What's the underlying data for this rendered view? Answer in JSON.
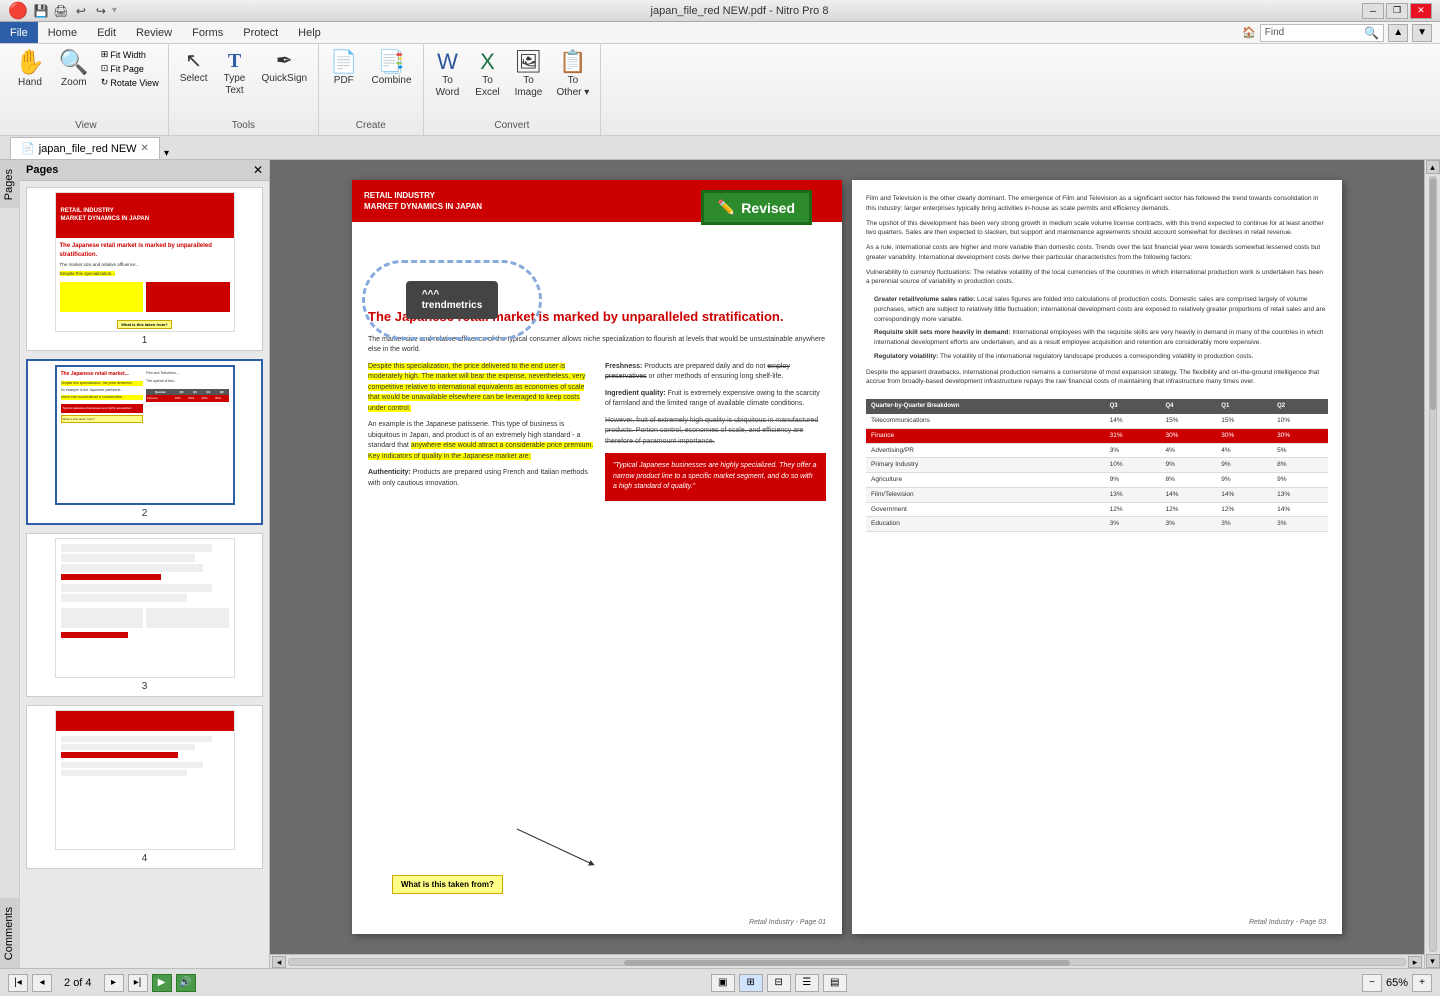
{
  "titlebar": {
    "title": "japan_file_red NEW.pdf - Nitro Pro 8",
    "minimize": "─",
    "restore": "❐",
    "close": "✕"
  },
  "menubar": {
    "items": [
      "File",
      "Home",
      "Edit",
      "Review",
      "Forms",
      "Protect",
      "Help"
    ],
    "active": "File",
    "find_placeholder": "Find"
  },
  "ribbon": {
    "groups": [
      {
        "label": "View",
        "items_small": [
          "Fit Width",
          "Fit Page",
          "Rotate View"
        ],
        "items_large": [
          {
            "icon": "✋",
            "label": "Hand"
          },
          {
            "icon": "🔍",
            "label": "Zoom"
          }
        ]
      },
      {
        "label": "Tools",
        "items": [
          {
            "icon": "↖",
            "label": "Select"
          },
          {
            "icon": "T",
            "label": "Type\nText"
          },
          {
            "icon": "✒",
            "label": "QuickSign"
          }
        ]
      },
      {
        "label": "Create",
        "items": [
          {
            "icon": "📄",
            "label": "PDF"
          },
          {
            "icon": "🔗",
            "label": "Combine"
          }
        ]
      },
      {
        "label": "Convert",
        "items": [
          {
            "icon": "W",
            "label": "To\nWord"
          },
          {
            "icon": "X",
            "label": "To\nExcel"
          },
          {
            "icon": "🖼",
            "label": "To\nImage"
          },
          {
            "icon": "▸",
            "label": "To\nOther"
          }
        ]
      }
    ]
  },
  "tabs": [
    {
      "label": "japan_file_red NEW",
      "active": true,
      "icon": "📄"
    }
  ],
  "sidebar": {
    "panels": [
      "Pages",
      "Comments"
    ],
    "active": "Pages"
  },
  "pages": {
    "total": 4,
    "current": 2,
    "items": [
      {
        "number": "1"
      },
      {
        "number": "2"
      },
      {
        "number": "3"
      },
      {
        "number": "4"
      }
    ]
  },
  "page_left": {
    "header_text": "RETAIL INDUSTRY\nMARKET DYNAMICS IN JAPAN",
    "revised_label": "Revised",
    "logo_text": "trendmetrics",
    "main_heading": "The Japanese retail market is marked by unparalleled stratification.",
    "intro_text": "The market size and relative affluence of the typical consumer allows niche specialization to flourish at levels that would be unsustainable anywhere else in the world.",
    "col1_highlighted": "Despite this specialization, the price delivered to the end user is moderately high. The market will bear the expense, nevertheless, very competitive relative to international equivalents as economies of scale that would be unavailable elsewhere can be leveraged to keep costs under control.",
    "col1_para2": "An example is the Japanese patisserie. This type of business is ubiquitous in Japan, and product is of an extremely high standard - a standard that anywhere else would attract a considerable price premium. Key indicators of quality in the Japanese market are:",
    "col2_freshness": "Freshness: Products are prepared daily and do not employ preservatives or other methods of ensuring long shelf-life.",
    "col2_ingredient": "Ingredient quality: Fruit is extremely expensive owing to the scarcity of farmland and the limited range of available climate conditions.",
    "col2_para3_strike": "However, fruit of extremely high quality is ubiquitous in manufactured products. Portion control, economies of scale, and efficiency are therefore of paramount importance.",
    "col2_authenticity": "Authenticity: Products are prepared using French and Italian methods with only cautious innovation.",
    "red_box_text": "\"Typical Japanese businesses are highly specialized. They offer a narrow product line to a specific market segment, and do so with a high standard of quality.\"",
    "annotation_text": "What is this taken from?",
    "footer": "Retail Industry - Page 01"
  },
  "page_right": {
    "para1": "Film and Television is the other clearly dominant. The emergence of Film and Television as a significant sector has followed the trend towards consolidation in this industry: larger enterprises typically bring activities in-house as scale permits and efficiency demands.",
    "para2": "The upshot of this development has been very strong growth in medium scale volume license contracts, with this trend expected to continue for at least another two quarters. Sales are then expected to slacken, but support and maintenance agreements should account somewhat for declines in retail revenue.",
    "para3": "As a rule, international costs are higher and more variable than domestic costs. Trends over the last financial year were towards somewhat lessened costs but greater variability. International development costs derive their particular characteristics from the following factors:",
    "para4": "Vulnerability to currency fluctuations: The relative volatility of the local currencies of the countries in which international production work is undertaken has been a perennial source of variability in production costs.",
    "bullet1_title": "Greater retail/volume sales ratio:",
    "bullet1_text": "Local sales figures are folded into calculations of production costs. Domestic sales are comprised largely of volume purchases, which are subject to relatively little fluctuation; international development costs are exposed to relatively greater proportions of retail sales and are correspondingly more variable.",
    "bullet2_title": "Requisite skill sets more heavily in demand:",
    "bullet2_text": "International employees with the requisite skills are very heavily in demand in many of the countries in which international development efforts are undertaken, and as a result employee acquisition and retention are considerably more expensive.",
    "bullet3_title": "Regulatory volatility:",
    "bullet3_text": "The volatility of the international regulatory landscape produces a corresponding volatility in production costs.",
    "closing": "Despite the apparent drawbacks, international production remains a cornerstone of most expansion strategy. The flexibility and on-the-ground intelligence that accrue from broadly-based development infrastructure repays the raw financial costs of maintaining that infrastructure many times over.",
    "table_title": "Quarter-by-Quarter Breakdown",
    "table_headers": [
      "",
      "Q3",
      "Q4",
      "Q1",
      "Q2"
    ],
    "table_rows": [
      {
        "label": "Telecommunications",
        "q3": "14%",
        "q4": "15%",
        "q1": "15%",
        "q2": "10%",
        "highlight": false
      },
      {
        "label": "Finance",
        "q3": "31%",
        "q4": "30%",
        "q1": "30%",
        "q2": "30%",
        "highlight": true
      },
      {
        "label": "Advertising/PR",
        "q3": "3%",
        "q4": "4%",
        "q1": "4%",
        "q2": "5%",
        "highlight": false
      },
      {
        "label": "Primary Industry",
        "q3": "10%",
        "q4": "9%",
        "q1": "9%",
        "q2": "8%",
        "highlight": false
      },
      {
        "label": "Agriculture",
        "q3": "9%",
        "q4": "8%",
        "q1": "9%",
        "q2": "9%",
        "highlight": false
      },
      {
        "label": "Film/Television",
        "q3": "13%",
        "q4": "14%",
        "q1": "14%",
        "q2": "13%",
        "highlight": false
      },
      {
        "label": "Government",
        "q3": "12%",
        "q4": "12%",
        "q1": "12%",
        "q2": "14%",
        "highlight": false
      },
      {
        "label": "Education",
        "q3": "3%",
        "q4": "3%",
        "q1": "3%",
        "q2": "3%",
        "highlight": false
      }
    ],
    "footer": "Retail Industry - Page 03"
  },
  "statusbar": {
    "page_current": "2",
    "page_total": "4",
    "page_label": "of",
    "zoom": "65%"
  }
}
